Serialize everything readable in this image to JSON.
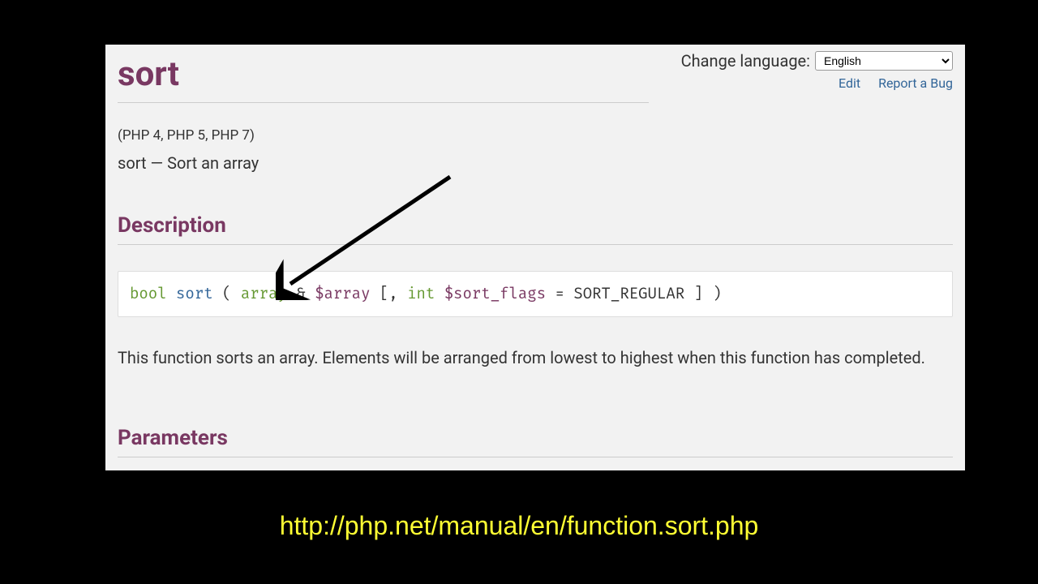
{
  "header": {
    "function_name": "sort",
    "lang_label": "Change language:",
    "lang_selected": "English",
    "lang_options": [
      "English"
    ],
    "edit_link": "Edit",
    "report_link": "Report a Bug"
  },
  "meta": {
    "versions": "(PHP 4, PHP 5, PHP 7)",
    "summary_name": "sort",
    "summary_sep": " — ",
    "summary_desc": "Sort an array"
  },
  "sections": {
    "description": "Description",
    "parameters": "Parameters"
  },
  "signature": {
    "return_type": "bool",
    "fn": "sort",
    "open": " ( ",
    "p1_type": "array",
    "p1_ref": " &",
    "p1_var": "$array",
    "opt_open": " [, ",
    "p2_type": "int",
    "p2_var": " $sort_flags",
    "p2_eq": " = ",
    "p2_default": "SORT_REGULAR",
    "opt_close": " ] ",
    "close": ")"
  },
  "description_text": "This function sorts an array. Elements will be arranged from lowest to highest when this function has completed.",
  "caption_url": "http://php.net/manual/en/function.sort.php"
}
